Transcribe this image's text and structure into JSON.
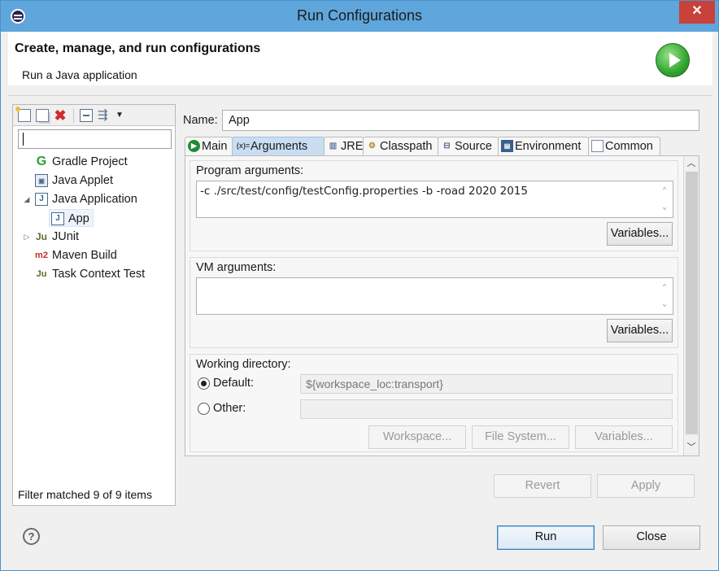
{
  "window": {
    "title": "Run Configurations",
    "close_glyph": "✕"
  },
  "header": {
    "title": "Create, manage, and run configurations",
    "subtitle": "Run a Java application",
    "logo_icon": "run-launch-icon"
  },
  "left": {
    "toolbar_icons": [
      "new-config-icon",
      "duplicate-icon",
      "delete-icon",
      "collapse-all-icon",
      "filter-icon",
      "view-menu-icon"
    ],
    "filter_value": "",
    "tree": [
      {
        "label": "Gradle Project",
        "icon": "gradle-icon",
        "icon_glyph": "G",
        "expanded": null
      },
      {
        "label": "Java Applet",
        "icon": "java-applet-icon",
        "icon_glyph": "▣",
        "expanded": null
      },
      {
        "label": "Java Application",
        "icon": "java-application-icon",
        "icon_glyph": "J",
        "expanded": true
      },
      {
        "label": "App",
        "icon": "java-application-icon",
        "icon_glyph": "J",
        "child": true,
        "selected": true
      },
      {
        "label": "JUnit",
        "icon": "junit-icon",
        "icon_glyph": "Ju",
        "expanded": false
      },
      {
        "label": "Maven Build",
        "icon": "maven-icon",
        "icon_glyph": "m2",
        "expanded": null
      },
      {
        "label": "Task Context Test",
        "icon": "task-context-icon",
        "icon_glyph": "Ju",
        "expanded": null
      }
    ],
    "status": "Filter matched 9 of 9 items"
  },
  "config": {
    "name_label": "Name:",
    "name_value": "App",
    "tabs": [
      {
        "label": "Main",
        "icon": "main-tab-icon",
        "glyph": "▶"
      },
      {
        "label": "Arguments",
        "icon": "arguments-tab-icon",
        "glyph": "(x)=",
        "active": true
      },
      {
        "label": "JRE",
        "icon": "jre-tab-icon",
        "glyph": "▥"
      },
      {
        "label": "Classpath",
        "icon": "classpath-tab-icon",
        "glyph": "⚙"
      },
      {
        "label": "Source",
        "icon": "source-tab-icon",
        "glyph": "⊟"
      },
      {
        "label": "Environment",
        "icon": "environment-tab-icon",
        "glyph": "▤"
      },
      {
        "label": "Common",
        "icon": "common-tab-icon",
        "glyph": "▭"
      }
    ],
    "program_args": {
      "label": "Program arguments:",
      "value": "-c ./src/test/config/testConfig.properties -b -road 2020 2015",
      "variables_button": "Variables..."
    },
    "vm_args": {
      "label": "VM arguments:",
      "value": "",
      "variables_button": "Variables..."
    },
    "working_dir": {
      "label": "Working directory:",
      "default_label": "Default:",
      "default_value": "${workspace_loc:transport}",
      "default_selected": true,
      "other_label": "Other:",
      "other_value": "",
      "workspace_button": "Workspace...",
      "filesystem_button": "File System...",
      "variables_button": "Variables..."
    },
    "revert_button": "Revert",
    "apply_button": "Apply"
  },
  "footer": {
    "help_glyph": "?",
    "run_button": "Run",
    "close_button": "Close"
  }
}
